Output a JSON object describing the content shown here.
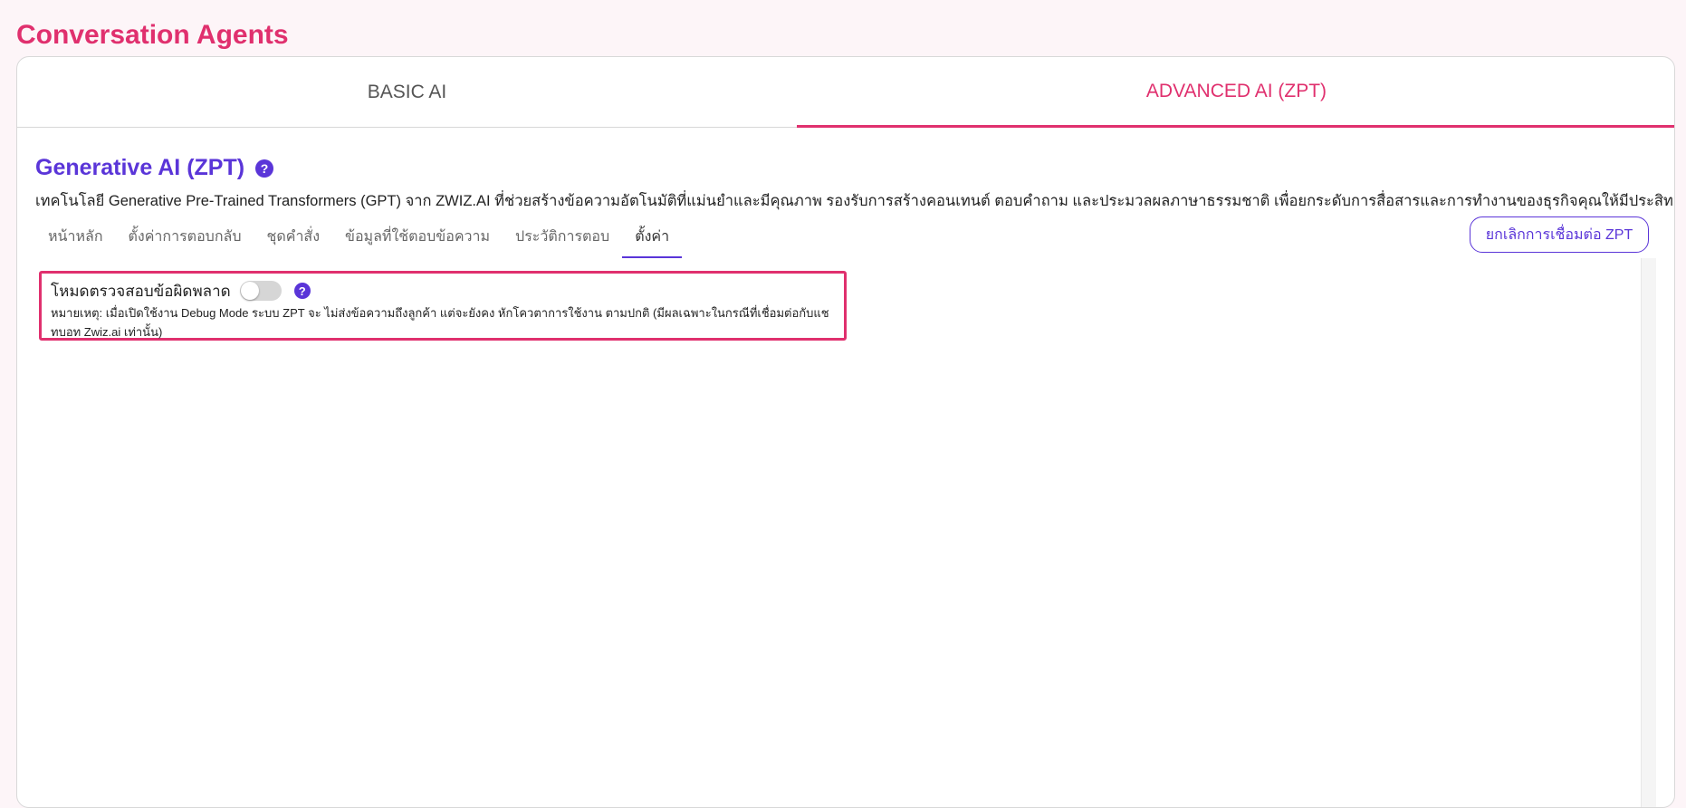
{
  "page": {
    "title": "Conversation Agents",
    "accent_color": "#e0306e",
    "primary_color": "#5a35d8"
  },
  "top_tabs": [
    {
      "label": "BASIC AI",
      "active": false
    },
    {
      "label": "ADVANCED AI (ZPT)",
      "active": true
    }
  ],
  "section": {
    "title": "Generative AI (ZPT)",
    "help_icon": "question-circle-icon",
    "description": "เทคโนโลยี Generative Pre-Trained Transformers (GPT) จาก ZWIZ.AI ที่ช่วยสร้างข้อความอัตโนมัติที่แม่นยำและมีคุณภาพ รองรับการสร้างคอนเทนต์ ตอบคำถาม และประมวลผลภาษาธรรมชาติ เพื่อยกระดับการสื่อสารและการทำงานของธุรกิจคุณให้มีประสิทธิภาพมากยิ่งขึ้น"
  },
  "sub_tabs": [
    {
      "label": "หน้าหลัก",
      "active": false
    },
    {
      "label": "ตั้งค่าการตอบกลับ",
      "active": false
    },
    {
      "label": "ชุดคำสั่ง",
      "active": false
    },
    {
      "label": "ข้อมูลที่ใช้ตอบข้อความ",
      "active": false
    },
    {
      "label": "ประวัติการตอบ",
      "active": false
    },
    {
      "label": "ตั้งค่า",
      "active": true
    }
  ],
  "disconnect_button": {
    "label": "ยกเลิกการเชื่อมต่อ ZPT"
  },
  "debug_mode": {
    "label": "โหมดตรวจสอบข้อผิดพลาด",
    "enabled": false,
    "note": "หมายเหตุ: เมื่อเปิดใช้งาน Debug Mode ระบบ ZPT จะ ไม่ส่งข้อความถึงลูกค้า แต่จะยังคง หักโควตาการใช้งาน ตามปกติ (มีผลเฉพาะในกรณีที่เชื่อมต่อกับแชทบอท Zwiz.ai เท่านั้น)"
  }
}
